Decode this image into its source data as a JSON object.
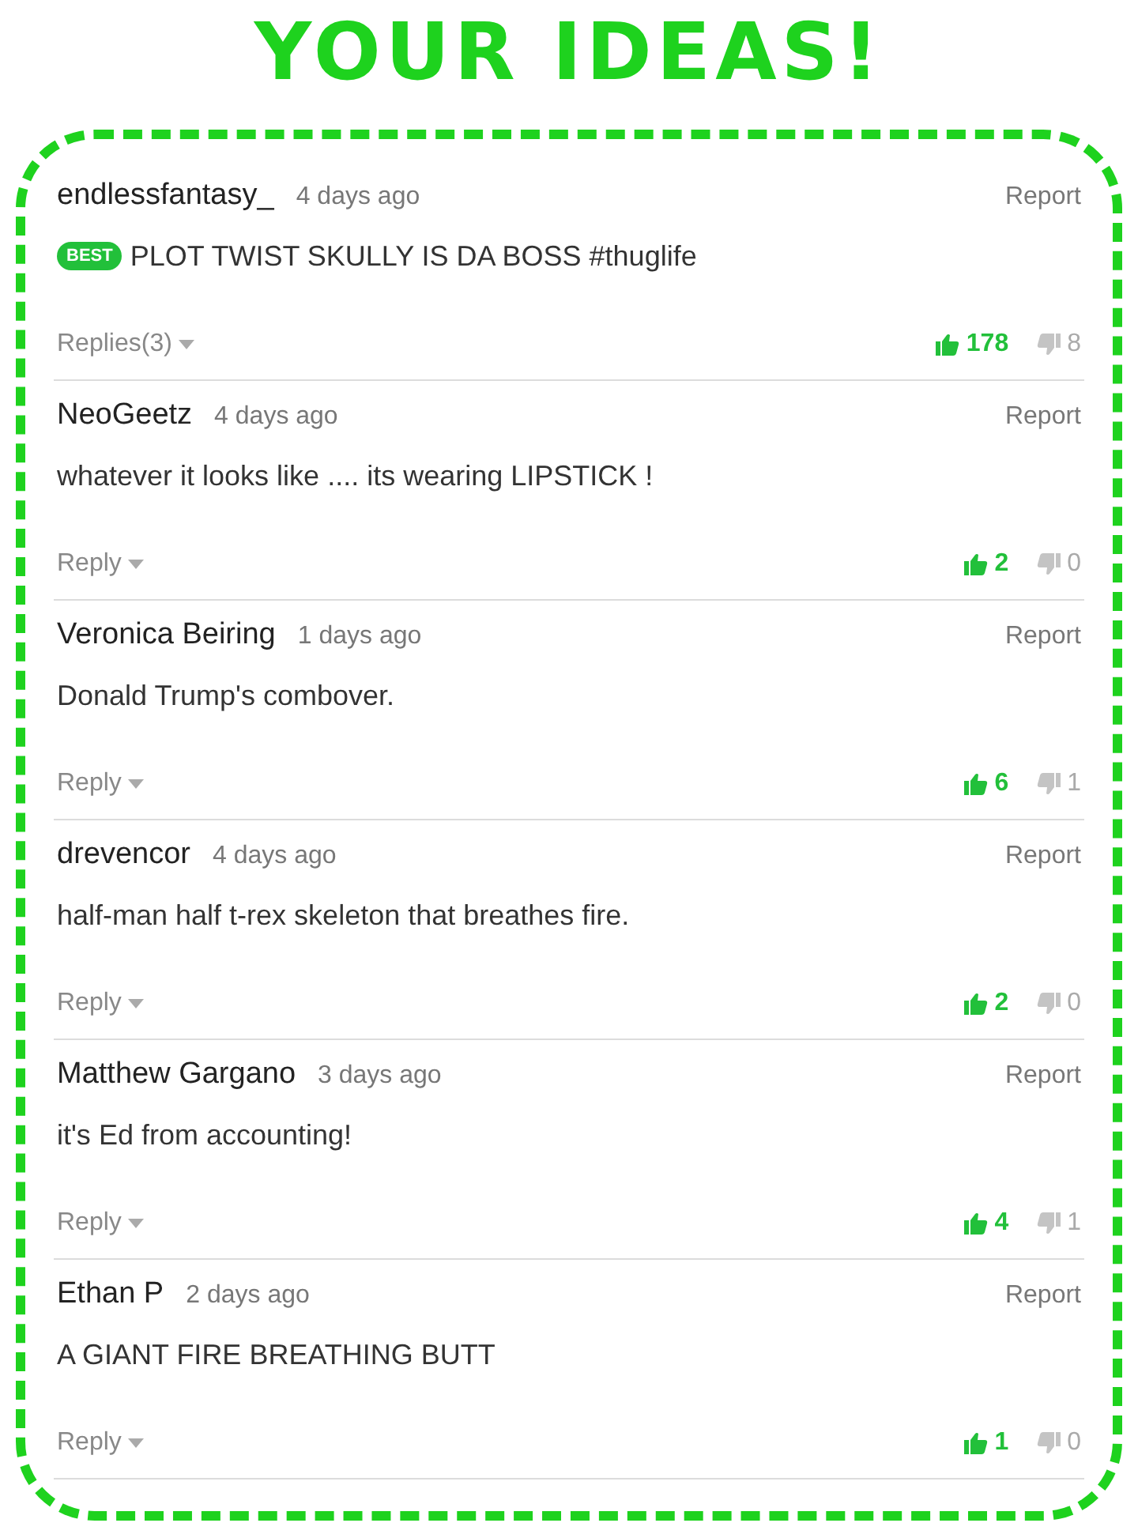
{
  "title": "YOUR IDEAS!",
  "comments": [
    {
      "author": "endlessfantasy_",
      "time": "4 days ago",
      "report": "Report",
      "badge": "BEST",
      "text": "PLOT TWIST SKULLY IS DA BOSS #thuglife",
      "reply": "Replies(3)",
      "likes": "178",
      "dislikes": "8"
    },
    {
      "author": "NeoGeetz",
      "time": "4 days ago",
      "report": "Report",
      "text": "whatever it looks like .... its wearing LIPSTICK !",
      "reply": "Reply",
      "likes": "2",
      "dislikes": "0"
    },
    {
      "author": "Veronica Beiring",
      "time": "1 days ago",
      "report": "Report",
      "text": "Donald Trump's combover.",
      "reply": "Reply",
      "likes": "6",
      "dislikes": "1"
    },
    {
      "author": "drevencor",
      "time": "4 days ago",
      "report": "Report",
      "text": "half-man half t-rex skeleton that breathes fire.",
      "reply": "Reply",
      "likes": "2",
      "dislikes": "0"
    },
    {
      "author": "Matthew Gargano",
      "time": "3 days ago",
      "report": "Report",
      "text": "it's Ed from accounting!",
      "reply": "Reply",
      "likes": "4",
      "dislikes": "1"
    },
    {
      "author": "Ethan P",
      "time": "2 days ago",
      "report": "Report",
      "text": "A GIANT FIRE BREATHING BUTT",
      "reply": "Reply",
      "likes": "1",
      "dislikes": "0"
    }
  ]
}
